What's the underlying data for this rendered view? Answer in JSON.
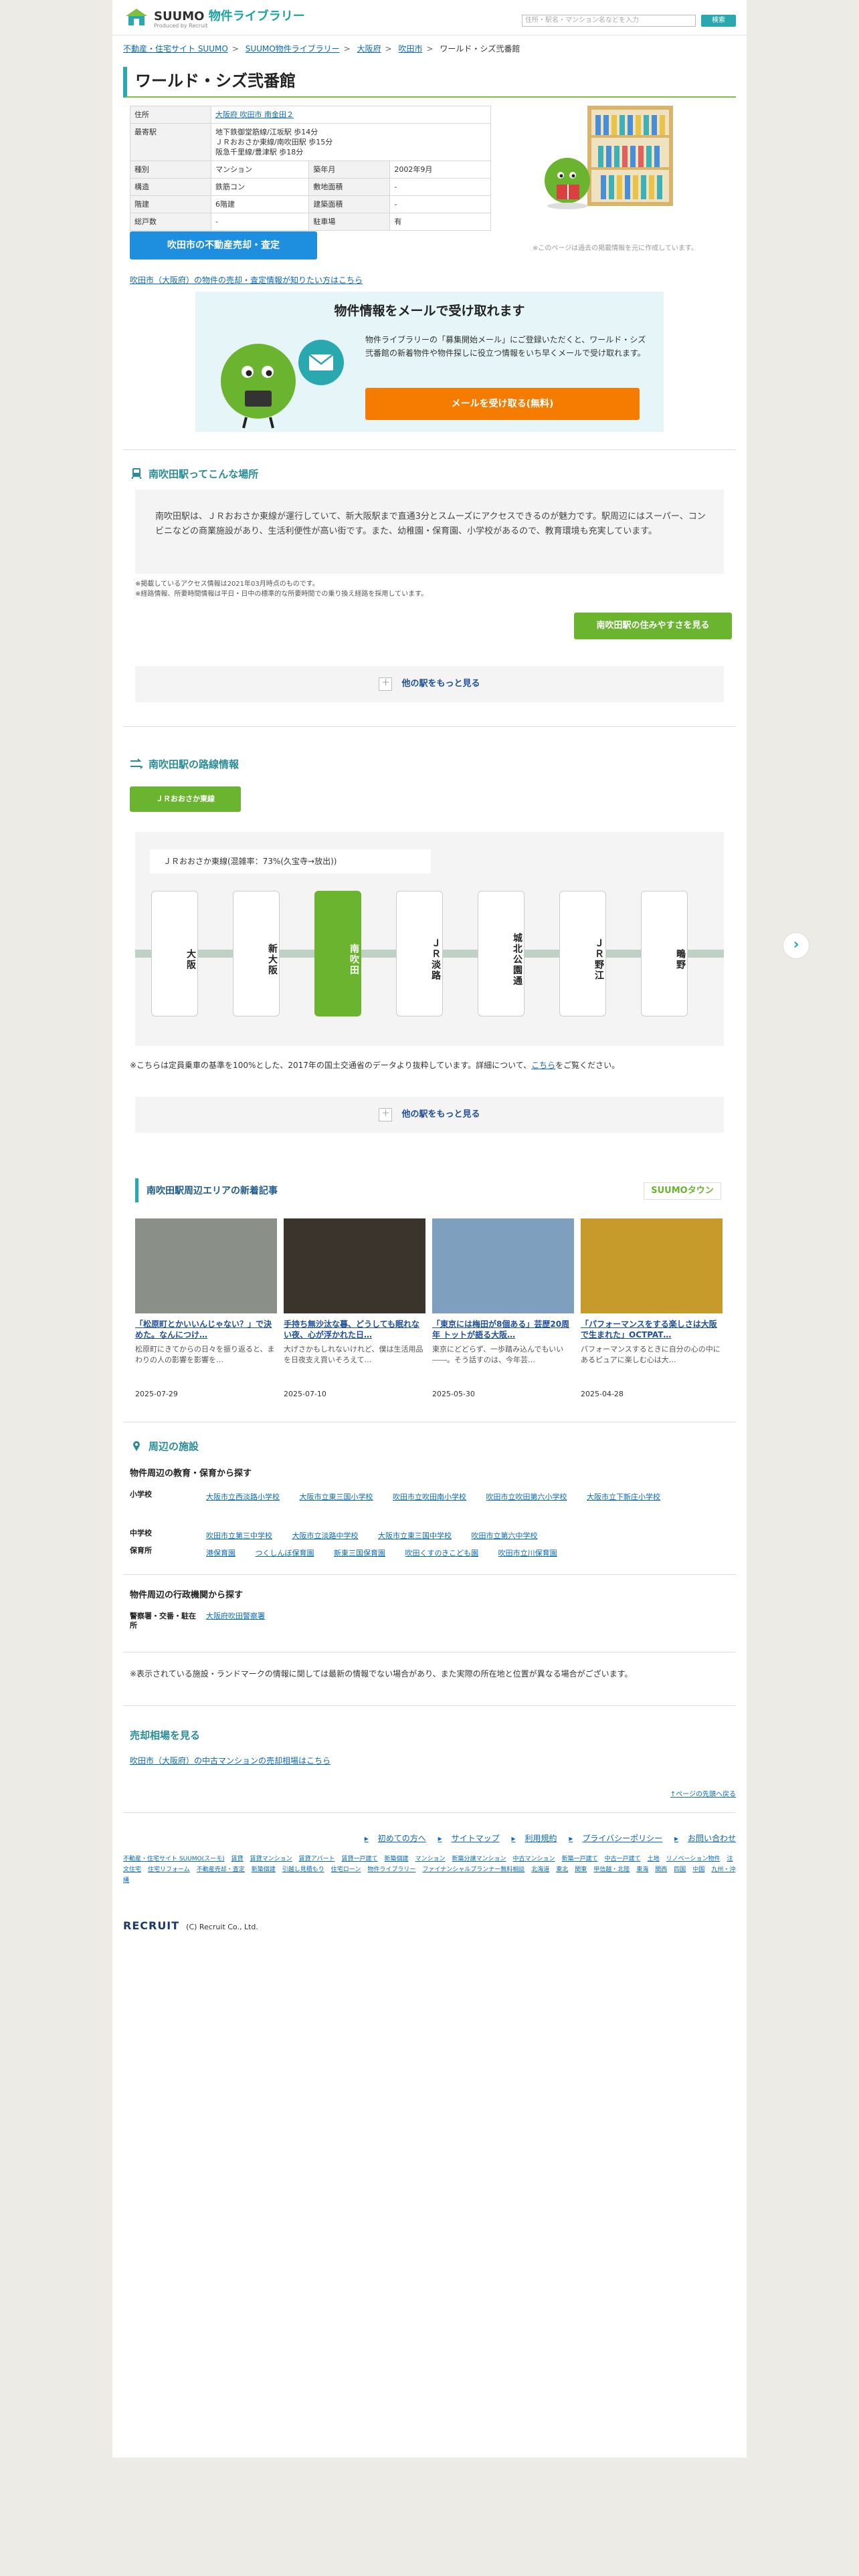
{
  "header": {
    "site_link": "不動産・住宅サイト SUUMO",
    "logo_suumo": "SUUMO",
    "logo_library": "物件ライブラリー",
    "logo_sub": "Produced by Recruit",
    "search_placeholder": "住所・駅名・マンション名などを入力",
    "search_button": "検索"
  },
  "breadcrumb": [
    "不動産・住宅サイト SUUMO",
    "SUUMO物件ライブラリー",
    "大阪府",
    "吹田市",
    "ワールド・シズ弐番館"
  ],
  "title": "ワールド・シズ弐番館",
  "spec": {
    "address_label": "住所",
    "address_value": "大阪府 吹田市 南金田２",
    "station_label": "最寄駅",
    "station_lines": [
      "地下鉄御堂筋線/江坂駅 歩14分",
      "ＪＲおおさか東線/南吹田駅 歩15分",
      "阪急千里線/豊津駅 歩18分"
    ],
    "rows": [
      {
        "k1": "種別",
        "v1": "マンション",
        "k2": "築年月",
        "v2": "2002年9月"
      },
      {
        "k1": "構造",
        "v1": "鉄筋コン",
        "k2": "敷地面積",
        "v2": "‐"
      },
      {
        "k1": "階建",
        "v1": "6階建",
        "k2": "建築面積",
        "v2": "‐"
      },
      {
        "k1": "総戸数",
        "v1": "‐",
        "k2": "駐車場",
        "v2": "有"
      }
    ]
  },
  "sale_button": "吹田市の不動産売却・査定",
  "note_right": "※このページは過去の掲載情報を元に作成しています。",
  "link_know": "吹田市（大阪府）の物件の売却・査定情報が知りたい方はこちら",
  "mail": {
    "title": "物件情報をメールで受け取れます",
    "desc": "物件ライブラリーの「募集開始メール」にご登録いただくと、ワールド・シズ弐番館の新着物件や物件探しに役立つ情報をいち早くメールで受け取れます。",
    "button": "メールを受け取る(無料)"
  },
  "about": {
    "title": "南吹田駅ってこんな場所",
    "text": "南吹田駅は、ＪＲおおさか東線が運行していて、新大阪駅まで直通3分とスムーズにアクセスできるのが魅力です。駅周辺にはスーパー、コンビニなどの商業施設があり、生活利便性が高い街です。また、幼稚園・保育園、小学校があるので、教育環境も充実しています。",
    "note1": "※掲載しているアクセス情報は2021年03月時点のものです。",
    "note2": "※経路情報、所要時間情報は平日・日中の標準的な所要時間での乗り換え経路を採用しています。",
    "button": "南吹田駅の住みやすさを見る",
    "more": "他の駅をもっと見る"
  },
  "route": {
    "title": "南吹田駅の路線情報",
    "tab": "ＪＲおおさか東線",
    "line_title": "ＪＲおおさか東線(混雑率：73%(久宝寺→放出))",
    "stations": [
      "大阪",
      "新大阪",
      "南吹田",
      "ＪＲ淡路",
      "城北公園通",
      "ＪＲ野江",
      "鴫野"
    ],
    "active_index": 2,
    "note_pre": "※こちらは定員乗車の基準を100%とした、2017年の国土交通省のデータより抜粋しています。詳細について、",
    "note_link": "こちら",
    "note_post": "をご覧ください。",
    "more": "他の駅をもっと見る"
  },
  "news": {
    "title": "南吹田駅周辺エリアの新着記事",
    "brand": "SUUMOタウン",
    "articles": [
      {
        "title": "「松原町とかいいんじゃない？」で決めた。なんにつけ…",
        "desc": "松原町にきてからの日々を振り返ると、まわりの人の影響を影響を…",
        "date": "2025-07-29",
        "color": "#8a8f88"
      },
      {
        "title": "手持ち無沙汰な暮、どうしても眠れない夜、心が浮かれた日…",
        "desc": "大げさかもしれないけれど、僕は生活用品を日夜支え買いそろえて…",
        "date": "2025-07-10",
        "color": "#3a342c"
      },
      {
        "title": "「東京には梅田が8個ある」芸歴20周年 トットが語る大阪…",
        "desc": "東京にどどらず、一歩踏み込んでもいい――。そう話すのは、今年芸…",
        "date": "2025-05-30",
        "color": "#7f9fbf"
      },
      {
        "title": "「パフォーマンスをする楽しさは大阪で生まれた」OCTPAT…",
        "desc": "パフォーマンスするときに自分の心の中にあるピュアに楽しむ心は大…",
        "date": "2025-04-28",
        "color": "#c79a2c"
      }
    ]
  },
  "facilities": {
    "title": "周辺の施設",
    "edu_title": "物件周辺の教育・保育から探す",
    "elem_label": "小学校",
    "elem": [
      "大阪市立西淡路小学校",
      "大阪市立東三国小学校",
      "吹田市立吹田南小学校",
      "吹田市立吹田第六小学校",
      "大阪市立下新庄小学校"
    ],
    "junior_label": "中学校",
    "junior": [
      "吹田市立第三中学校",
      "大阪市立淡路中学校",
      "大阪市立東三国中学校",
      "吹田市立第六中学校"
    ],
    "nursery_label": "保育所",
    "nursery": [
      "港保育園",
      "つくしんぼ保育園",
      "新東三国保育園",
      "吹田くすのきこども園",
      "吹田市立川保育園"
    ],
    "gov_title": "物件周辺の行政機関から探す",
    "police_label": "警察署・交番・駐在所",
    "police": [
      "大阪府吹田警察署"
    ],
    "note": "※表示されている施設・ランドマークの情報に関しては最新の情報でない場合があり、また実際の所在地と位置が異なる場合がございます。"
  },
  "sell": {
    "title": "売却相場を見る",
    "link": "吹田市（大阪府）の中古マンションの売却相場はこちら",
    "back_top": "ページの先頭へ戻る"
  },
  "footer": {
    "nav": [
      "初めての方へ",
      "サイトマップ",
      "利用規約",
      "プライバシーポリシー",
      "お問い合わせ"
    ],
    "links": [
      "不動産・住宅サイト SUUMO(スーモ)",
      "賃貸",
      "賃貸マンション",
      "賃貸アパート",
      "賃貸一戸建て",
      "新築個建",
      "マンション",
      "新築分譲マンション",
      "中古マンション",
      "新築一戸建て",
      "中古一戸建て",
      "土地",
      "リノベーション物件",
      "注文住宅",
      "住宅リフォーム",
      "不動産売却・査定",
      "新築個建",
      "引越し見積もり",
      "住宅ローン",
      "物件ライブラリー",
      "ファイナンシャルプランナー無料相談",
      "北海道",
      "東北",
      "関東",
      "甲信越・北陸",
      "東海",
      "関西",
      "四国",
      "中国",
      "九州・沖縄"
    ],
    "company": "RECRUIT",
    "copyright": "(C) Recruit Co., Ltd."
  }
}
